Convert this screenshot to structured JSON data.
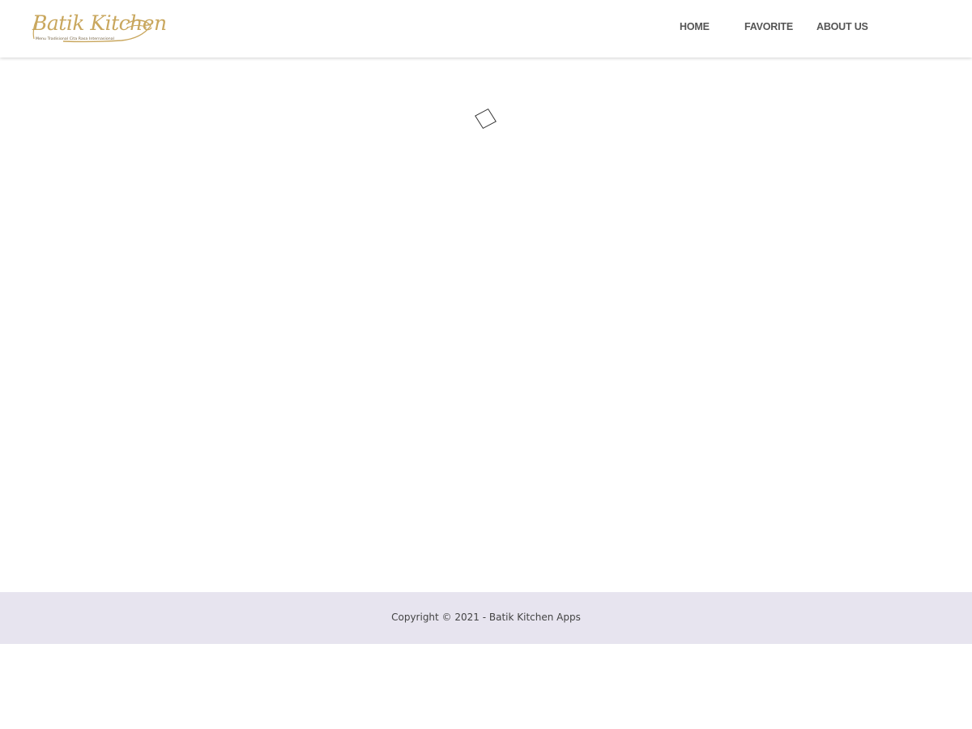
{
  "brand": {
    "name": "Batik Kitchen",
    "tagline": "Menu Tradisional Cita Rasa Internasional",
    "color": "#c9a75e"
  },
  "nav": {
    "items": [
      {
        "label": "HOME"
      },
      {
        "label": "FAVORITE"
      },
      {
        "label": "ABOUT US"
      }
    ],
    "text_color": "#555555"
  },
  "main": {
    "loader": {
      "icon": "loading-spinner-icon",
      "state": "loading"
    }
  },
  "footer": {
    "copyright": "Copyright © 2021 - Batik Kitchen Apps",
    "background": "#e7e4ef"
  }
}
